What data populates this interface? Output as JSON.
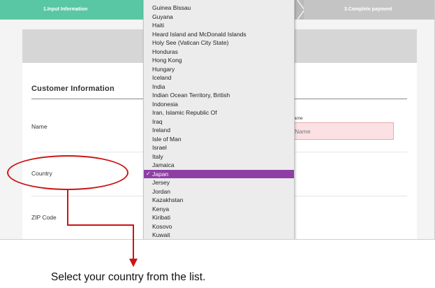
{
  "steps": {
    "step1_label": "1.Input Information",
    "step3_label": "3.Complete payment",
    "active_color": "#59c7a4"
  },
  "form": {
    "section_title": "Customer Information",
    "rows": {
      "name": "Name",
      "country": "Country",
      "zip": "ZIP Code"
    },
    "name_field_label": "ame",
    "name_input_placeholder": "Name"
  },
  "dropdown": {
    "options": [
      "Guinea Bissau",
      "Guyana",
      "Haiti",
      "Heard Island and McDonald Islands",
      "Holy See (Vatican City State)",
      "Honduras",
      "Hong Kong",
      "Hungary",
      "Iceland",
      "India",
      "Indian Ocean Territory, British",
      "Indonesia",
      "Iran, Islamic Republic Of",
      "Iraq",
      "Ireland",
      "Isle of Man",
      "Israel",
      "Italy",
      "Jamaica",
      "Japan",
      "Jersey",
      "Jordan",
      "Kazakhstan",
      "Kenya",
      "Kiribati",
      "Kosovo",
      "Kuwait"
    ],
    "selected": "Japan",
    "selected_color": "#8e3fa5"
  },
  "annotation": {
    "caption": "Select your country from the list.",
    "color": "#cc1414"
  }
}
